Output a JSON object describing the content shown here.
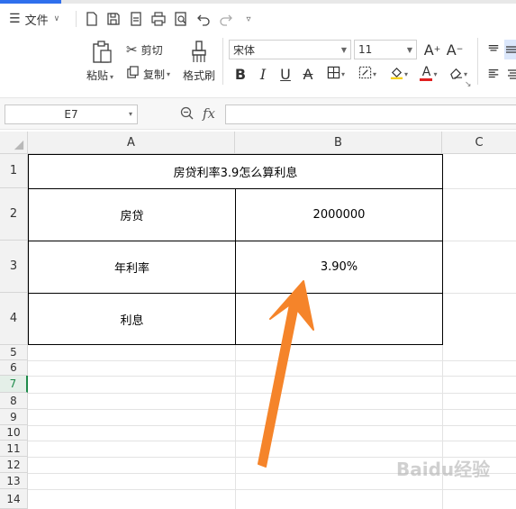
{
  "menu": {
    "file_label": "文件"
  },
  "ribbon": {
    "paste_label": "粘贴",
    "cut_label": "剪切",
    "copy_label": "复制",
    "format_painter_label": "格式刷",
    "font_name": "宋体",
    "font_size": "11",
    "grow_font": "A",
    "shrink_font": "A",
    "bold": "B",
    "italic": "I",
    "underline": "U",
    "strike": "A",
    "font_color_letter": "A"
  },
  "formula_bar": {
    "name_box": "E7",
    "fx_label": "fx",
    "value": ""
  },
  "grid": {
    "columns": [
      "A",
      "B",
      "C"
    ],
    "rows": [
      "1",
      "2",
      "3",
      "4",
      "5",
      "6",
      "7",
      "8",
      "9",
      "10",
      "11",
      "12",
      "13",
      "14"
    ],
    "selected_row": "7"
  },
  "cells": {
    "title": "房贷利率3.9怎么算利息",
    "a2": "房贷",
    "b2": "2000000",
    "a3": "年利率",
    "b3": "3.90%",
    "a4": "利息",
    "b4": ""
  },
  "colors": {
    "accent": "#2f6fed",
    "arrow": "#f5842a",
    "selected_row": "#1e8b4a"
  },
  "watermark": {
    "text": "Baidu经验"
  }
}
